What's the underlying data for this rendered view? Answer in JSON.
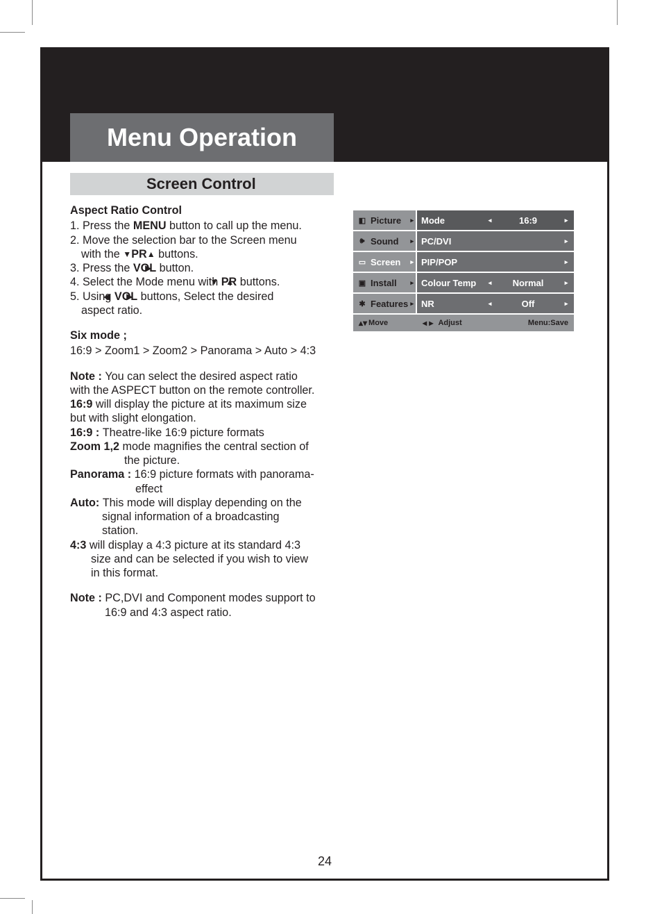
{
  "title": "Menu Operation",
  "subtitle": "Screen Control",
  "aspect_heading": "Aspect Ratio Control",
  "steps": {
    "s1a": "1. Press the ",
    "s1b": "MENU",
    "s1c": " button to call up the menu.",
    "s2a": "2. Move the selection bar to the Screen menu",
    "s2b": "with the ",
    "s2c": "PR",
    "s2d": " buttons.",
    "s3a": "3. Press the ",
    "s3b": "VOL",
    "s3c": " button.",
    "s4a": "4. Select the Mode menu with ",
    "s4b": "PR",
    "s4c": " buttons.",
    "s5a": "5. Using ",
    "s5b": "VOL",
    "s5c": " buttons, Select the desired",
    "s5d": "aspect ratio."
  },
  "sixmode_h": "Six mode ;",
  "sixmode": "16:9 > Zoom1 > Zoom2 > Panorama > Auto > 4:3",
  "note1": {
    "lbl": "Note : ",
    "l1": "You can select the desired aspect ratio",
    "l2": "with the ASPECT button on the remote controller."
  },
  "desc": {
    "d169a": "16:9",
    "d169b": " will display the picture at its maximum size",
    "d169c": "but with slight elongation.",
    "d169_2a": "16:9 : ",
    "d169_2b": "Theatre-like 16:9 picture formats",
    "zoom_a": "Zoom 1,2",
    "zoom_b": " mode magnifies the central section of",
    "zoom_c": "the picture.",
    "pan_a": "Panorama : ",
    "pan_b": "16:9 picture formats with panorama-",
    "pan_c": "effect",
    "auto_a": "Auto: ",
    "auto_b": "This mode will display depending on the",
    "auto_c": "signal information of a broadcasting",
    "auto_d": "station.",
    "r43_a": "4:3",
    "r43_b": " will display a 4:3 picture at its standard 4:3",
    "r43_c": "size and can be selected if you wish to view",
    "r43_d": "in this format."
  },
  "note2": {
    "lbl": "Note : ",
    "l1": "PC,DVI and Component modes support to",
    "l2": "16:9 and 4:3 aspect ratio."
  },
  "osd": {
    "cats": [
      "Picture",
      "Sound",
      "Screen",
      "Install",
      "Features"
    ],
    "rows": [
      {
        "label": "Mode",
        "left": true,
        "val": "16:9",
        "right": true
      },
      {
        "label": "PC/DVI",
        "left": false,
        "val": "",
        "right": true
      },
      {
        "label": "PIP/POP",
        "left": false,
        "val": "",
        "right": true
      },
      {
        "label": "Colour Temp",
        "left": true,
        "val": "Normal",
        "right": true
      },
      {
        "label": "NR",
        "left": true,
        "val": "Off",
        "right": true
      }
    ],
    "foot": {
      "move": "Move",
      "adjust": "Adjust",
      "menu": "Menu:Save"
    }
  },
  "pagenum": "24"
}
